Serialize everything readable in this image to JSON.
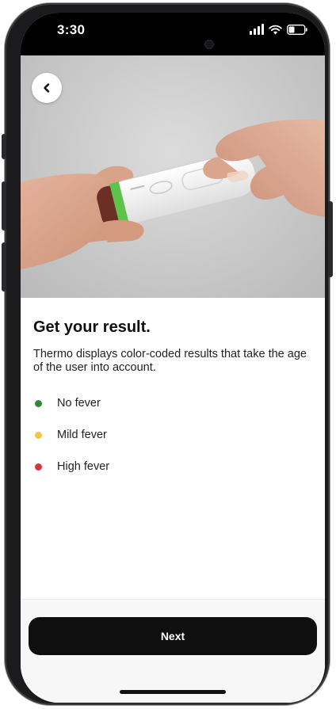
{
  "status_bar": {
    "time": "3:30",
    "icons": [
      "signal-icon",
      "wifi-icon",
      "battery-icon"
    ]
  },
  "hero": {
    "image": "thermometer-in-hands",
    "back_icon": "chevron-left-icon"
  },
  "content": {
    "title": "Get your result.",
    "description": "Thermo displays color-coded results that take the age of the user into account.",
    "legend": [
      {
        "label": "No fever",
        "color": "#2e8b35"
      },
      {
        "label": "Mild fever",
        "color": "#f4c542"
      },
      {
        "label": "High fever",
        "color": "#d6343f"
      }
    ]
  },
  "footer": {
    "next_label": "Next"
  },
  "colors": {
    "primary_button": "#0f0f0f",
    "thermometer_accent": "#5fc24a"
  }
}
